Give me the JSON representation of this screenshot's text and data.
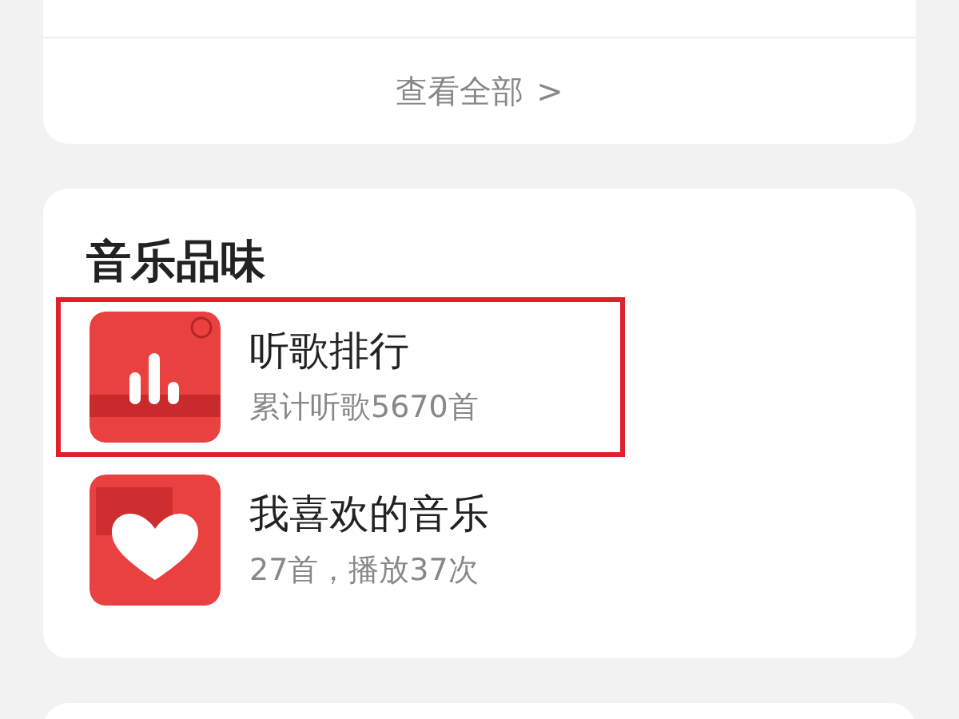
{
  "top_card": {
    "view_all": "查看全部",
    "chevron": ">"
  },
  "music_taste": {
    "title": "音乐品味",
    "items": [
      {
        "kind": "ranking",
        "title": "听歌排行",
        "subtitle": "累计听歌5670首",
        "highlighted": true
      },
      {
        "kind": "favorites",
        "title": "我喜欢的音乐",
        "subtitle": "27首，播放37次",
        "highlighted": false
      }
    ]
  }
}
